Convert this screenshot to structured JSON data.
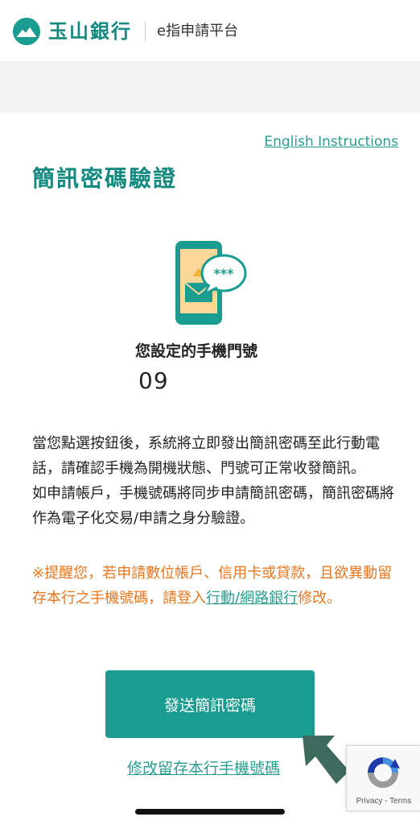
{
  "header": {
    "brand": "玉山銀行",
    "platform": "e指申請平台"
  },
  "english_link": "English Instructions",
  "page_title": "簡訊密碼驗證",
  "phone": {
    "label": "您設定的手機門號",
    "number": "09"
  },
  "description": {
    "line1": "當您點選按鈕後，系統將立即發出簡訊密碼至此行動電話，請確認手機為開機狀態、門號可正常收發簡訊。",
    "line2": "如申請帳戶，手機號碼將同步申請簡訊密碼，簡訊密碼將作為電子化交易/申請之身分驗證。"
  },
  "reminder": {
    "text_before": "※提醒您，若申請數位帳戶、信用卡或貸款，且欲異動留存本行之手機號碼，請登入",
    "link_mobile": "行動",
    "separator": "/",
    "link_web": "網路銀行",
    "text_after": "修改。"
  },
  "send_button": "發送簡訊密碼",
  "modify_link": "修改留存本行手機號碼",
  "recaptcha": {
    "text": "Privacy - Terms"
  },
  "colors": {
    "brand": "#13897f",
    "button": "#1a9c90",
    "link": "#2a9d90",
    "reminder": "#e8761e"
  }
}
